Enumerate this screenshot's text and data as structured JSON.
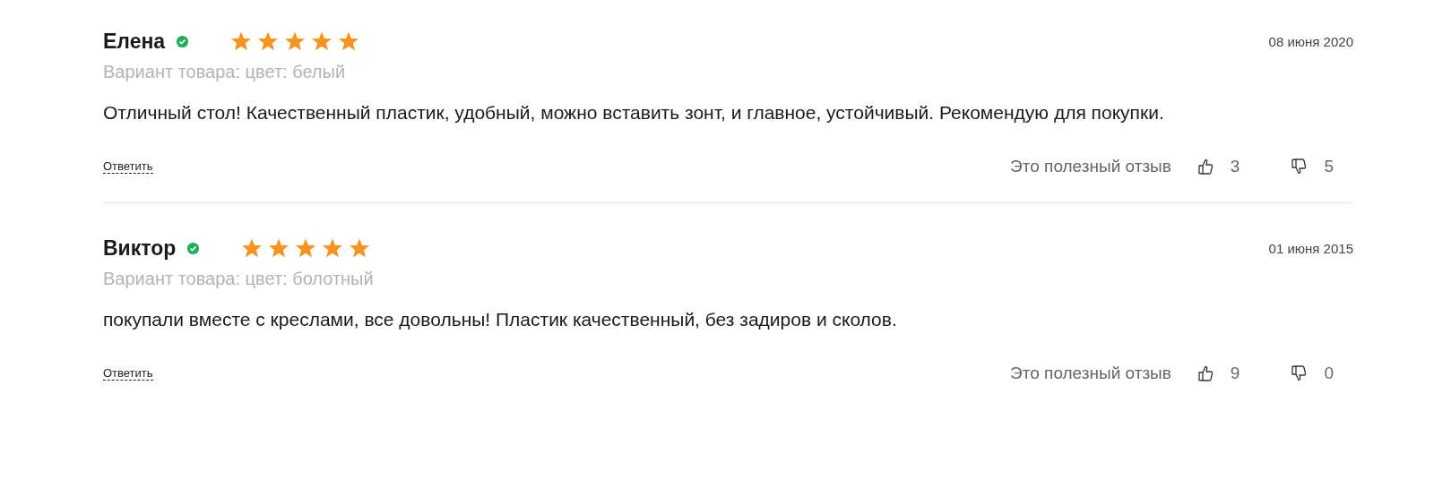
{
  "reviews": [
    {
      "author": "Елена",
      "verified": true,
      "stars": 5,
      "date": "08 июня 2020",
      "variant": "Вариант товара: цвет: белый",
      "text": "Отличный стол! Качественный пластик, удобный, можно вставить зонт, и главное, устойчивый. Рекомендую для покупки.",
      "reply": "Ответить",
      "helpful_label": "Это полезный отзыв",
      "likes": "3",
      "dislikes": "5"
    },
    {
      "author": "Виктор",
      "verified": true,
      "stars": 5,
      "date": "01 июня 2015",
      "variant": "Вариант товара: цвет: болотный",
      "text": "покупали вместе с креслами, все довольны! Пластик качественный, без задиров и сколов.",
      "reply": "Ответить",
      "helpful_label": "Это полезный отзыв",
      "likes": "9",
      "dislikes": "0"
    }
  ]
}
